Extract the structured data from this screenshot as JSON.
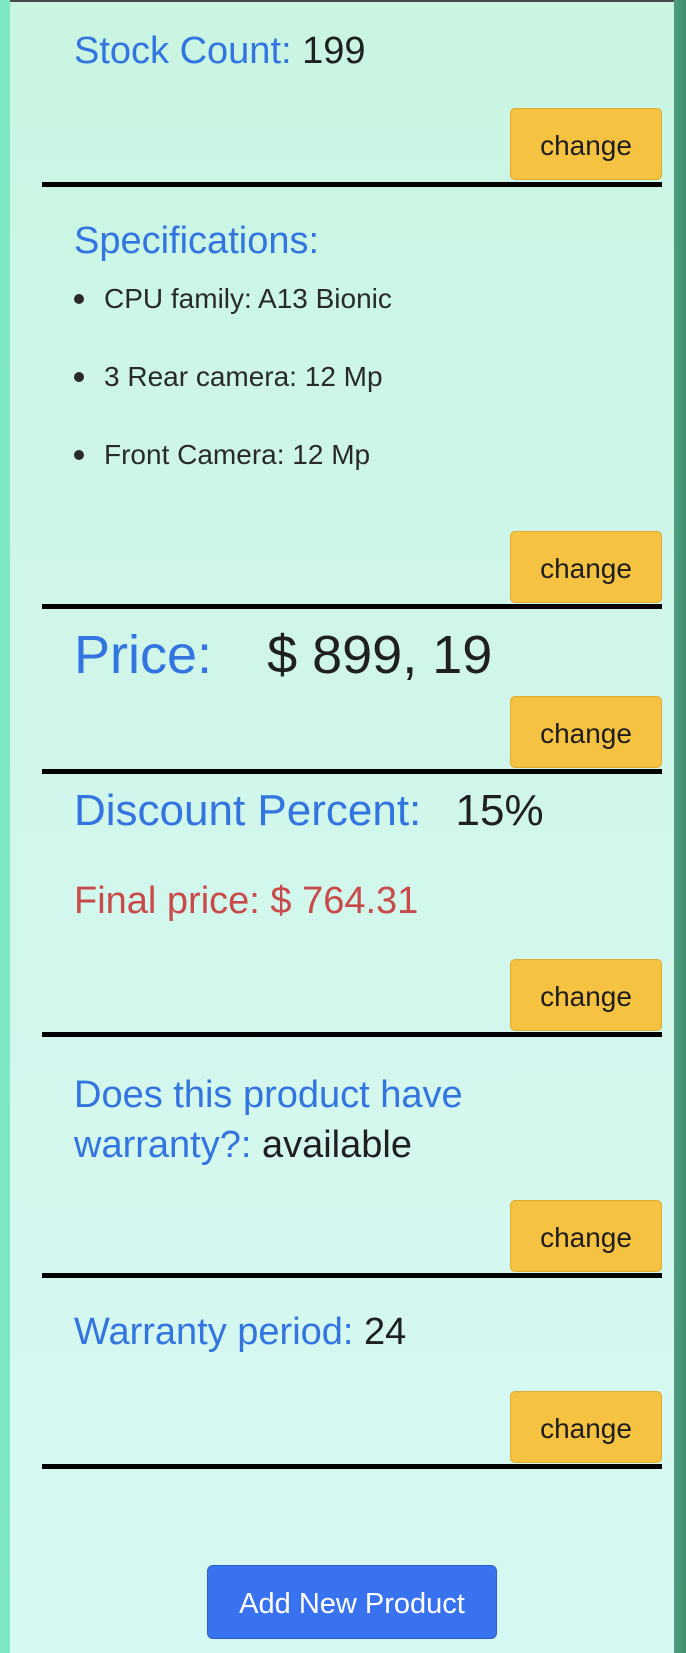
{
  "stock": {
    "label": "Stock Count:",
    "value": "199"
  },
  "specifications": {
    "label": "Specifications:",
    "items": [
      {
        "text": "CPU family: A13 Bionic"
      },
      {
        "text": "3 Rear camera: 12 Mp"
      },
      {
        "text": "Front Camera: 12 Mp"
      }
    ]
  },
  "price": {
    "label": "Price:",
    "value": "$ 899, 19"
  },
  "discount": {
    "label": "Discount Percent:",
    "value": "15%",
    "final_label": "Final price: $ 764.31"
  },
  "warranty": {
    "label": "Does this product have warranty?:",
    "label_line1": "Does this product have",
    "label_line2": "warranty?:",
    "value": "available"
  },
  "warranty_period": {
    "label": "Warranty period:",
    "value": "24"
  },
  "buttons": {
    "change": "change",
    "add_new": "Add New Product"
  },
  "colors": {
    "label": "#3274e0",
    "change_button": "#f5c242",
    "add_button": "#3872ee",
    "final_price": "#c84a4a"
  }
}
